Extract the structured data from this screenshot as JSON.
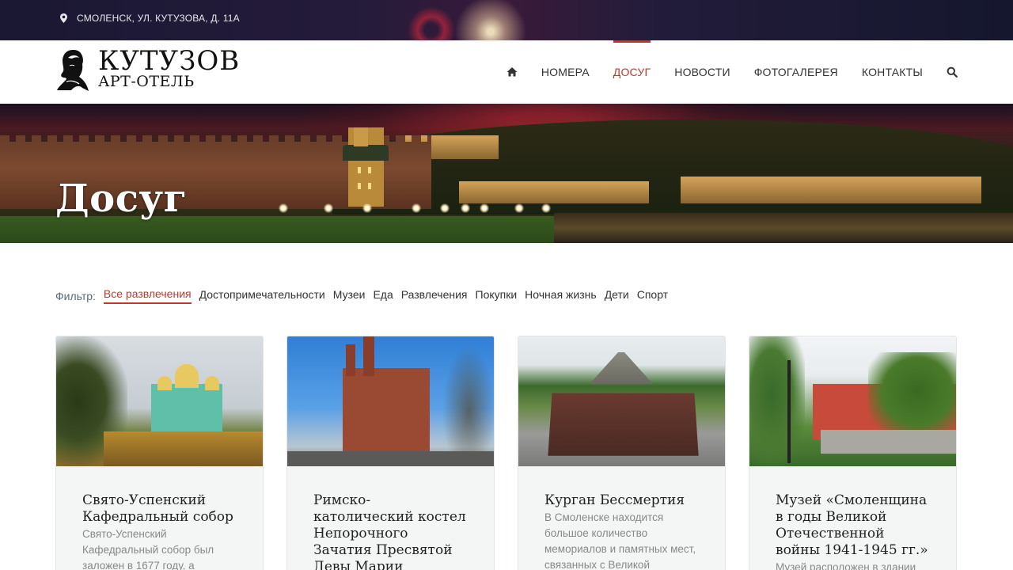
{
  "topbar": {
    "address": "СМОЛЕНСК, УЛ. КУТУЗОВА, Д. 11А"
  },
  "logo": {
    "title": "КУТУЗОВ",
    "subtitle": "АРТ-ОТЕЛЬ"
  },
  "nav": {
    "items": [
      {
        "label": "НОМЕРА"
      },
      {
        "label": "ДОСУГ",
        "active": true
      },
      {
        "label": "НОВОСТИ"
      },
      {
        "label": "ФОТОГАЛЕРЕЯ"
      },
      {
        "label": "КОНТАКТЫ"
      }
    ]
  },
  "hero": {
    "title": "Досуг"
  },
  "filter": {
    "label": "Фильтр:",
    "items": [
      {
        "label": "Все развлечения",
        "active": true
      },
      {
        "label": "Достопримечательности"
      },
      {
        "label": "Музеи"
      },
      {
        "label": "Еда"
      },
      {
        "label": "Развлечения"
      },
      {
        "label": "Покупки"
      },
      {
        "label": "Ночная жизнь"
      },
      {
        "label": "Дети"
      },
      {
        "label": "Спорт"
      }
    ]
  },
  "cards": [
    {
      "title": "Свято-Успенский Кафедральный собор",
      "text": "Свято-Успенский Кафедральный собор был заложен в 1677 году, а"
    },
    {
      "title": "Римско-католический костел Непорочного Зачатия Пресвятой Девы Марии",
      "text": ""
    },
    {
      "title": "Курган Бессмертия",
      "text": "В Смоленске находится большое количество мемориалов и памятных мест, связанных с Великой"
    },
    {
      "title": "Музей «Смоленщина в годы Великой Отечественной войны 1941-1945 гг.»",
      "text": "Музей расположен в здании"
    }
  ],
  "colors": {
    "accent": "#c0392b",
    "text": "#333333",
    "muted": "#888888"
  }
}
